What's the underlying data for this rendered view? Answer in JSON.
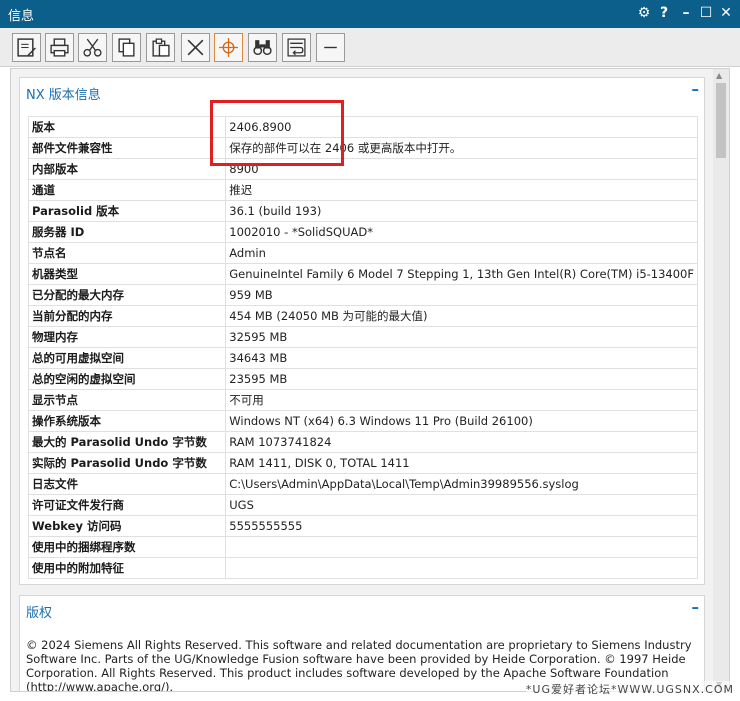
{
  "window": {
    "title": "信息",
    "controls": {
      "settings": "⚙",
      "help": "?",
      "minimize": "–",
      "maximize": "☐",
      "close": "✕"
    }
  },
  "toolbar": {
    "items": [
      {
        "name": "save-icon"
      },
      {
        "name": "print-icon"
      },
      {
        "name": "cut-icon"
      },
      {
        "name": "copy-icon"
      },
      {
        "name": "paste-icon"
      },
      {
        "name": "clear-icon"
      },
      {
        "name": "crosshair-icon"
      },
      {
        "name": "binoculars-icon"
      },
      {
        "name": "wrap-text-icon"
      },
      {
        "name": "collapse-icon"
      }
    ]
  },
  "info_panel": {
    "title": "NX 版本信息",
    "collapse_symbol": "–",
    "rows": [
      {
        "key": "版本",
        "value": "2406.8900"
      },
      {
        "key": "部件文件兼容性",
        "value": "保存的部件可以在 2406 或更高版本中打开。"
      },
      {
        "key": "内部版本",
        "value": "8900"
      },
      {
        "key": "通道",
        "value": "推迟"
      },
      {
        "key": "Parasolid 版本",
        "value": "36.1 (build 193)"
      },
      {
        "key": "服务器 ID",
        "value": "1002010 - *SolidSQUAD*"
      },
      {
        "key": "节点名",
        "value": "Admin"
      },
      {
        "key": "机器类型",
        "value": "GenuineIntel Family 6 Model 7 Stepping 1, 13th Gen Intel(R) Core(TM) i5-13400F"
      },
      {
        "key": "已分配的最大内存",
        "value": "959 MB"
      },
      {
        "key": "当前分配的内存",
        "value": "454 MB (24050 MB 为可能的最大值)"
      },
      {
        "key": "物理内存",
        "value": "32595 MB"
      },
      {
        "key": "总的可用虚拟空间",
        "value": "34643 MB"
      },
      {
        "key": "总的空闲的虚拟空间",
        "value": "23595 MB"
      },
      {
        "key": "显示节点",
        "value": "不可用"
      },
      {
        "key": "操作系统版本",
        "value": "Windows NT (x64) 6.3 Windows 11 Pro (Build 26100)"
      },
      {
        "key": "最大的 Parasolid Undo 字节数",
        "value": "RAM 1073741824"
      },
      {
        "key": "实际的 Parasolid Undo 字节数",
        "value": "RAM 1411, DISK 0, TOTAL 1411"
      },
      {
        "key": "日志文件",
        "value": "C:\\Users\\Admin\\AppData\\Local\\Temp\\Admin39989556.syslog"
      },
      {
        "key": "许可证文件发行商",
        "value": "UGS"
      },
      {
        "key": "Webkey 访问码",
        "value": "5555555555"
      },
      {
        "key": "使用中的捆绑程序数",
        "value": ""
      },
      {
        "key": "使用中的附加特征",
        "value": ""
      }
    ]
  },
  "copyright_panel": {
    "title": "版权",
    "collapse_symbol": "–",
    "text": "© 2024 Siemens All Rights Reserved. This software and related documentation are proprietary to Siemens Industry Software Inc. Parts of the UG/Knowledge Fusion software have been provided by Heide Corporation. © 1997 Heide Corporation. All Rights Reserved. This product includes software developed by the Apache Software Foundation (http://www.apache.org/)."
  },
  "watermark": "*UG爱好者论坛*WWW.UGSNX.COM",
  "colors": {
    "titlebar": "#0b5f8a",
    "accent": "#1a6fb0",
    "highlight_box": "#e02020"
  }
}
